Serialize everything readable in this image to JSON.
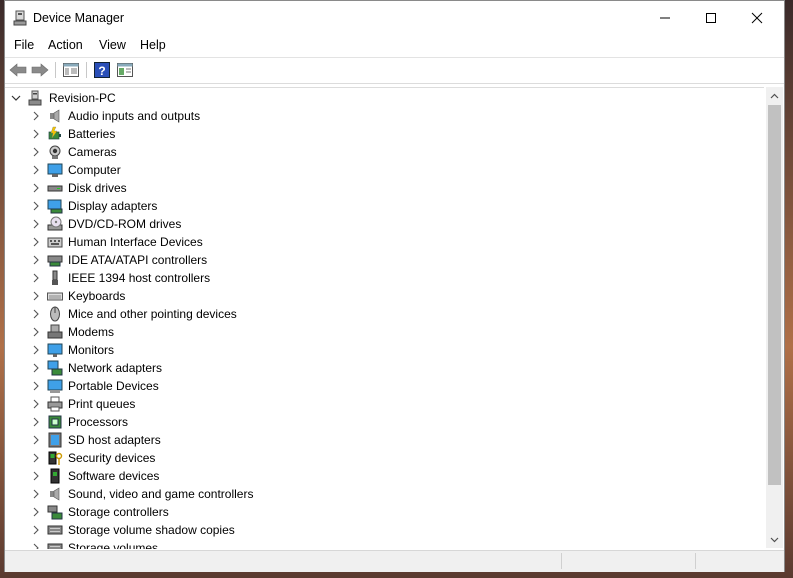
{
  "window": {
    "title": "Device Manager"
  },
  "menu": [
    {
      "label": "File"
    },
    {
      "label": "Action"
    },
    {
      "label": "View"
    },
    {
      "label": "Help"
    }
  ],
  "toolbar": {
    "buttons": [
      {
        "icon": "back-arrow-icon"
      },
      {
        "icon": "forward-arrow-icon"
      },
      {
        "icon": "show-hide-console-tree-icon"
      },
      {
        "icon": "help-icon"
      },
      {
        "icon": "properties-icon"
      }
    ]
  },
  "tree": {
    "root": {
      "label": "Revision-PC",
      "icon": "computer-tree-root-icon"
    },
    "categories": [
      {
        "label": "Audio inputs and outputs",
        "icon": "speaker-icon"
      },
      {
        "label": "Batteries",
        "icon": "battery-icon"
      },
      {
        "label": "Cameras",
        "icon": "camera-icon"
      },
      {
        "label": "Computer",
        "icon": "computer-icon"
      },
      {
        "label": "Disk drives",
        "icon": "disk-drive-icon"
      },
      {
        "label": "Display adapters",
        "icon": "display-adapter-icon"
      },
      {
        "label": "DVD/CD-ROM drives",
        "icon": "dvd-drive-icon"
      },
      {
        "label": "Human Interface Devices",
        "icon": "hid-icon"
      },
      {
        "label": "IDE ATA/ATAPI controllers",
        "icon": "ide-controller-icon"
      },
      {
        "label": "IEEE 1394 host controllers",
        "icon": "ieee1394-icon"
      },
      {
        "label": "Keyboards",
        "icon": "keyboard-icon"
      },
      {
        "label": "Mice and other pointing devices",
        "icon": "mouse-icon"
      },
      {
        "label": "Modems",
        "icon": "modem-icon"
      },
      {
        "label": "Monitors",
        "icon": "monitor-icon"
      },
      {
        "label": "Network adapters",
        "icon": "network-adapter-icon"
      },
      {
        "label": "Portable Devices",
        "icon": "portable-device-icon"
      },
      {
        "label": "Print queues",
        "icon": "printer-icon"
      },
      {
        "label": "Processors",
        "icon": "processor-icon"
      },
      {
        "label": "SD host adapters",
        "icon": "sd-card-icon"
      },
      {
        "label": "Security devices",
        "icon": "security-device-icon"
      },
      {
        "label": "Software devices",
        "icon": "software-device-icon"
      },
      {
        "label": "Sound, video and game controllers",
        "icon": "sound-controller-icon"
      },
      {
        "label": "Storage controllers",
        "icon": "storage-controller-icon"
      },
      {
        "label": "Storage volume shadow copies",
        "icon": "shadow-copy-icon"
      },
      {
        "label": "Storage volumes",
        "icon": "storage-volume-icon"
      }
    ]
  },
  "colors": {
    "accent": "#1e73be",
    "scroll_thumb": "#c1c1c1"
  }
}
